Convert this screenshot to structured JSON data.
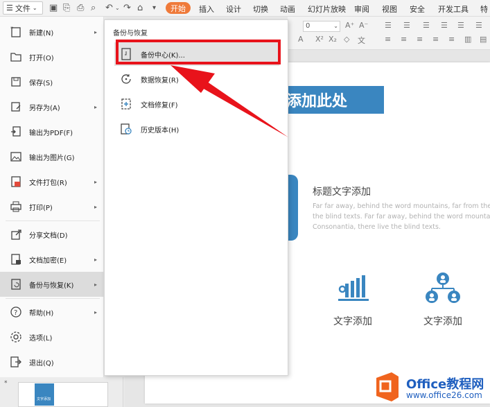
{
  "toolbar": {
    "file_label": "文件",
    "tabs": [
      "开始",
      "插入",
      "设计",
      "切换",
      "动画",
      "幻灯片放映",
      "审阅",
      "视图",
      "安全",
      "开发工具",
      "特"
    ],
    "font_size_value": "0"
  },
  "file_menu": {
    "items": [
      {
        "label": "新建(N)",
        "icon": "new-icon",
        "has_submenu": true
      },
      {
        "label": "打开(O)",
        "icon": "folder-open-icon",
        "has_submenu": false
      },
      {
        "label": "保存(S)",
        "icon": "save-icon",
        "has_submenu": false
      },
      {
        "label": "另存为(A)",
        "icon": "save-as-icon",
        "has_submenu": true
      },
      {
        "label": "输出为PDF(F)",
        "icon": "pdf-icon",
        "has_submenu": false
      },
      {
        "label": "输出为图片(G)",
        "icon": "image-icon",
        "has_submenu": false
      },
      {
        "label": "文件打包(R)",
        "icon": "package-icon",
        "has_submenu": true
      },
      {
        "label": "打印(P)",
        "icon": "print-icon",
        "has_submenu": true
      },
      {
        "label": "分享文档(D)",
        "icon": "share-icon",
        "has_submenu": false
      },
      {
        "label": "文档加密(E)",
        "icon": "encrypt-icon",
        "has_submenu": true
      },
      {
        "label": "备份与恢复(K)",
        "icon": "backup-icon",
        "has_submenu": true,
        "selected": true
      },
      {
        "label": "帮助(H)",
        "icon": "help-icon",
        "has_submenu": true
      },
      {
        "label": "选项(L)",
        "icon": "gear-icon",
        "has_submenu": false
      },
      {
        "label": "退出(Q)",
        "icon": "exit-icon",
        "has_submenu": false
      }
    ]
  },
  "submenu": {
    "title": "备份与恢复",
    "items": [
      {
        "label": "备份中心(K)...",
        "icon": "backup-center-icon",
        "highlighted": true
      },
      {
        "label": "数据恢复(R)",
        "icon": "data-recovery-icon"
      },
      {
        "label": "文档修复(F)",
        "icon": "document-repair-icon"
      },
      {
        "label": "历史版本(H)",
        "icon": "history-version-icon"
      }
    ]
  },
  "slide": {
    "title": "添加此处",
    "heading": "标题文字添加",
    "body_lines": [
      "Far far away, behind the word mountains, far from the",
      "the blind texts. Far far away, behind the word mountai",
      "Consonantia, there live the blind texts."
    ],
    "captions": [
      "文字添加",
      "文字添加"
    ]
  },
  "thumbnail": {
    "star": "*",
    "label": "文字添加"
  },
  "watermark": {
    "title": "Office教程网",
    "url": "www.office26.com"
  },
  "colors": {
    "accent_orange": "#ef7a3a",
    "slide_blue": "#3a86c0",
    "highlight_red": "#e8131b",
    "watermark_orange": "#f0641e",
    "watermark_blue": "#1f5fbf"
  }
}
